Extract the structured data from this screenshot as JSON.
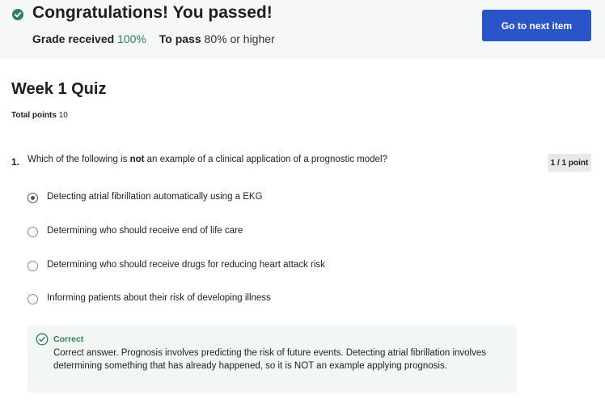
{
  "banner": {
    "title": "Congratulations! You passed!",
    "grade_label": "Grade received",
    "grade_value": "100%",
    "pass_label": "To pass",
    "pass_value": "80% or higher",
    "next_button": "Go to next item",
    "success_color": "#2e7d5b",
    "button_color": "#2a55c9"
  },
  "quiz": {
    "title": "Week 1 Quiz",
    "total_points_label": "Total points",
    "total_points_value": "10"
  },
  "question": {
    "number": "1.",
    "text_before": "Which of the following is ",
    "text_bold": "not",
    "text_after": " an example of a clinical application of a prognostic model?",
    "points": "1 / 1 point",
    "options": [
      {
        "label": "Detecting atrial fibrillation automatically using a EKG",
        "selected": true
      },
      {
        "label": "Determining who should receive end of life care",
        "selected": false
      },
      {
        "label": "Determining who should receive drugs for reducing heart attack risk",
        "selected": false
      },
      {
        "label": "Informing patients about their risk of developing illness",
        "selected": false
      }
    ],
    "feedback": {
      "title": "Correct",
      "text": "Correct answer.  Prognosis involves predicting the risk of future events.  Detecting atrial fibrillation involves determining something that has already happened, so it is NOT an example applying prognosis."
    }
  }
}
